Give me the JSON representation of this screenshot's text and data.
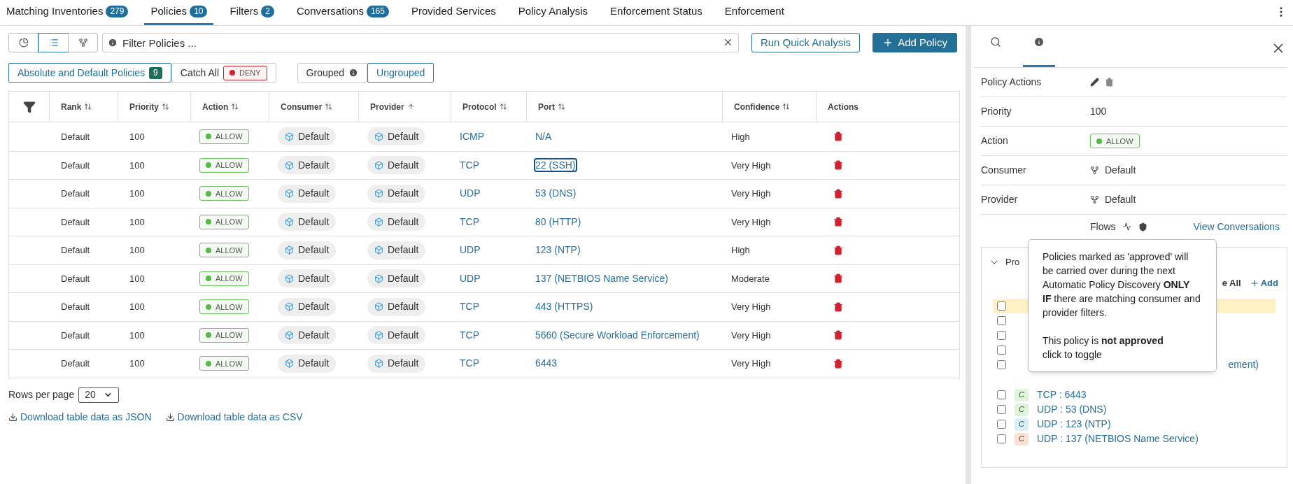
{
  "top_tabs": [
    {
      "label": "Matching Inventories",
      "count": "279",
      "selected": false
    },
    {
      "label": "Policies",
      "count": "10",
      "selected": true
    },
    {
      "label": "Filters",
      "count": "2",
      "selected": false
    },
    {
      "label": "Conversations",
      "count": "165",
      "selected": false
    },
    {
      "label": "Provided Services",
      "selected": false
    },
    {
      "label": "Policy Analysis",
      "selected": false
    },
    {
      "label": "Enforcement Status",
      "selected": false
    },
    {
      "label": "Enforcement",
      "selected": false
    }
  ],
  "view_toggles": [
    {
      "kind": "chart",
      "selected": false
    },
    {
      "kind": "list",
      "selected": true
    },
    {
      "kind": "graph",
      "selected": false
    }
  ],
  "filter": {
    "placeholder": "Filter Policies ..."
  },
  "buttons": [
    {
      "label": "Run Quick Analysis",
      "kind": "outline"
    },
    {
      "label": "Add Policy",
      "kind": "primary"
    }
  ],
  "policy_tabs": [
    {
      "label": "Absolute and Default Policies",
      "count": "9",
      "selected": true
    },
    {
      "label": "Catch All",
      "tag": "DENY",
      "selected": false
    }
  ],
  "grouping": [
    {
      "label": "Grouped",
      "info": true,
      "selected": false
    },
    {
      "label": "Ungrouped",
      "selected": true
    }
  ],
  "table": {
    "columns": [
      {
        "label": "Rank",
        "kind": "sortable"
      },
      {
        "label": "Priority",
        "kind": "sortable"
      },
      {
        "label": "Action",
        "kind": "sortable"
      },
      {
        "label": "Consumer",
        "kind": "sortable"
      },
      {
        "label": "Provider",
        "kind": "ascending"
      },
      {
        "label": "Protocol",
        "kind": "sortable"
      },
      {
        "label": "Port",
        "kind": "sortable"
      },
      {
        "label": "Confidence",
        "kind": "sortable"
      },
      {
        "label": "Actions",
        "kind": "plain"
      }
    ],
    "rows": [
      {
        "rank": "Default",
        "priority": "100",
        "action": {
          "label": "ALLOW",
          "kind": "allow"
        },
        "consumer": "Default",
        "provider": "Default",
        "protocol": "ICMP",
        "port": "N/A",
        "port_focused": false,
        "confidence": "High"
      },
      {
        "rank": "Default",
        "priority": "100",
        "action": {
          "label": "ALLOW",
          "kind": "allow"
        },
        "consumer": "Default",
        "provider": "Default",
        "protocol": "TCP",
        "port": "22 (SSH)",
        "port_focused": true,
        "confidence": "Very High"
      },
      {
        "rank": "Default",
        "priority": "100",
        "action": {
          "label": "ALLOW",
          "kind": "allow"
        },
        "consumer": "Default",
        "provider": "Default",
        "protocol": "UDP",
        "port": "53 (DNS)",
        "port_focused": false,
        "confidence": "Very High"
      },
      {
        "rank": "Default",
        "priority": "100",
        "action": {
          "label": "ALLOW",
          "kind": "allow"
        },
        "consumer": "Default",
        "provider": "Default",
        "protocol": "TCP",
        "port": "80 (HTTP)",
        "port_focused": false,
        "confidence": "Very High"
      },
      {
        "rank": "Default",
        "priority": "100",
        "action": {
          "label": "ALLOW",
          "kind": "allow"
        },
        "consumer": "Default",
        "provider": "Default",
        "protocol": "UDP",
        "port": "123 (NTP)",
        "port_focused": false,
        "confidence": "High"
      },
      {
        "rank": "Default",
        "priority": "100",
        "action": {
          "label": "ALLOW",
          "kind": "allow"
        },
        "consumer": "Default",
        "provider": "Default",
        "protocol": "UDP",
        "port": "137 (NETBIOS Name Service)",
        "port_focused": false,
        "confidence": "Moderate"
      },
      {
        "rank": "Default",
        "priority": "100",
        "action": {
          "label": "ALLOW",
          "kind": "allow"
        },
        "consumer": "Default",
        "provider": "Default",
        "protocol": "TCP",
        "port": "443 (HTTPS)",
        "port_focused": false,
        "confidence": "Very High"
      },
      {
        "rank": "Default",
        "priority": "100",
        "action": {
          "label": "ALLOW",
          "kind": "allow"
        },
        "consumer": "Default",
        "provider": "Default",
        "protocol": "TCP",
        "port": "5660 (Secure Workload Enforcement)",
        "port_focused": false,
        "confidence": "Very High"
      },
      {
        "rank": "Default",
        "priority": "100",
        "action": {
          "label": "ALLOW",
          "kind": "allow"
        },
        "consumer": "Default",
        "provider": "Default",
        "protocol": "TCP",
        "port": "6443",
        "port_focused": false,
        "confidence": "Very High"
      }
    ]
  },
  "pagination": {
    "label": "Rows per page",
    "value": "20"
  },
  "downloads": [
    "Download table data as JSON",
    "Download table data as CSV"
  ],
  "side_panel": {
    "tabs": [
      {
        "kind": "search",
        "selected": false
      },
      {
        "kind": "info",
        "selected": true
      }
    ],
    "details": [
      {
        "label": "Policy Actions",
        "kind": "actions"
      },
      {
        "label": "Priority",
        "kind": "text",
        "value": "100"
      },
      {
        "label": "Action",
        "kind": "action",
        "tag": {
          "label": "ALLOW",
          "kind": "allow"
        }
      },
      {
        "label": "Consumer",
        "kind": "scope",
        "value": "Default"
      },
      {
        "label": "Provider",
        "kind": "scope",
        "value": "Default"
      }
    ],
    "flows": {
      "label": "Flows",
      "link": "View Conversations"
    },
    "section": {
      "title": "Pro",
      "expanded": true,
      "actions": [
        {
          "label": "e All",
          "kind": "text"
        },
        {
          "label": "Add",
          "kind": "add"
        }
      ],
      "rows": [
        {
          "checked": false,
          "highlighted": true
        },
        {
          "checked": false,
          "highlighted": false
        },
        {
          "checked": false,
          "highlighted": false
        },
        {
          "checked": false,
          "highlighted": false
        },
        {
          "checked": false,
          "highlighted": false,
          "text": "ement)"
        }
      ],
      "services": [
        {
          "badge": "C",
          "color": "#dff5d9",
          "text": "TCP : 6443",
          "checked": false
        },
        {
          "badge": "C",
          "color": "#dff5d9",
          "text": "UDP : 53 (DNS)",
          "checked": false
        },
        {
          "badge": "C",
          "color": "#d9eefb",
          "text": "UDP : 123 (NTP)",
          "checked": false
        },
        {
          "badge": "C",
          "color": "#fbe3d3",
          "text": "UDP : 137 (NETBIOS Name Service)",
          "checked": false
        }
      ]
    },
    "tooltip": {
      "lines": [
        "Policies marked as 'approved' will be carried over during the next Automatic Policy Discovery **ONLY IF** there are matching consumer and provider filters.",
        "This policy is **not approved**",
        "click to toggle"
      ]
    }
  }
}
